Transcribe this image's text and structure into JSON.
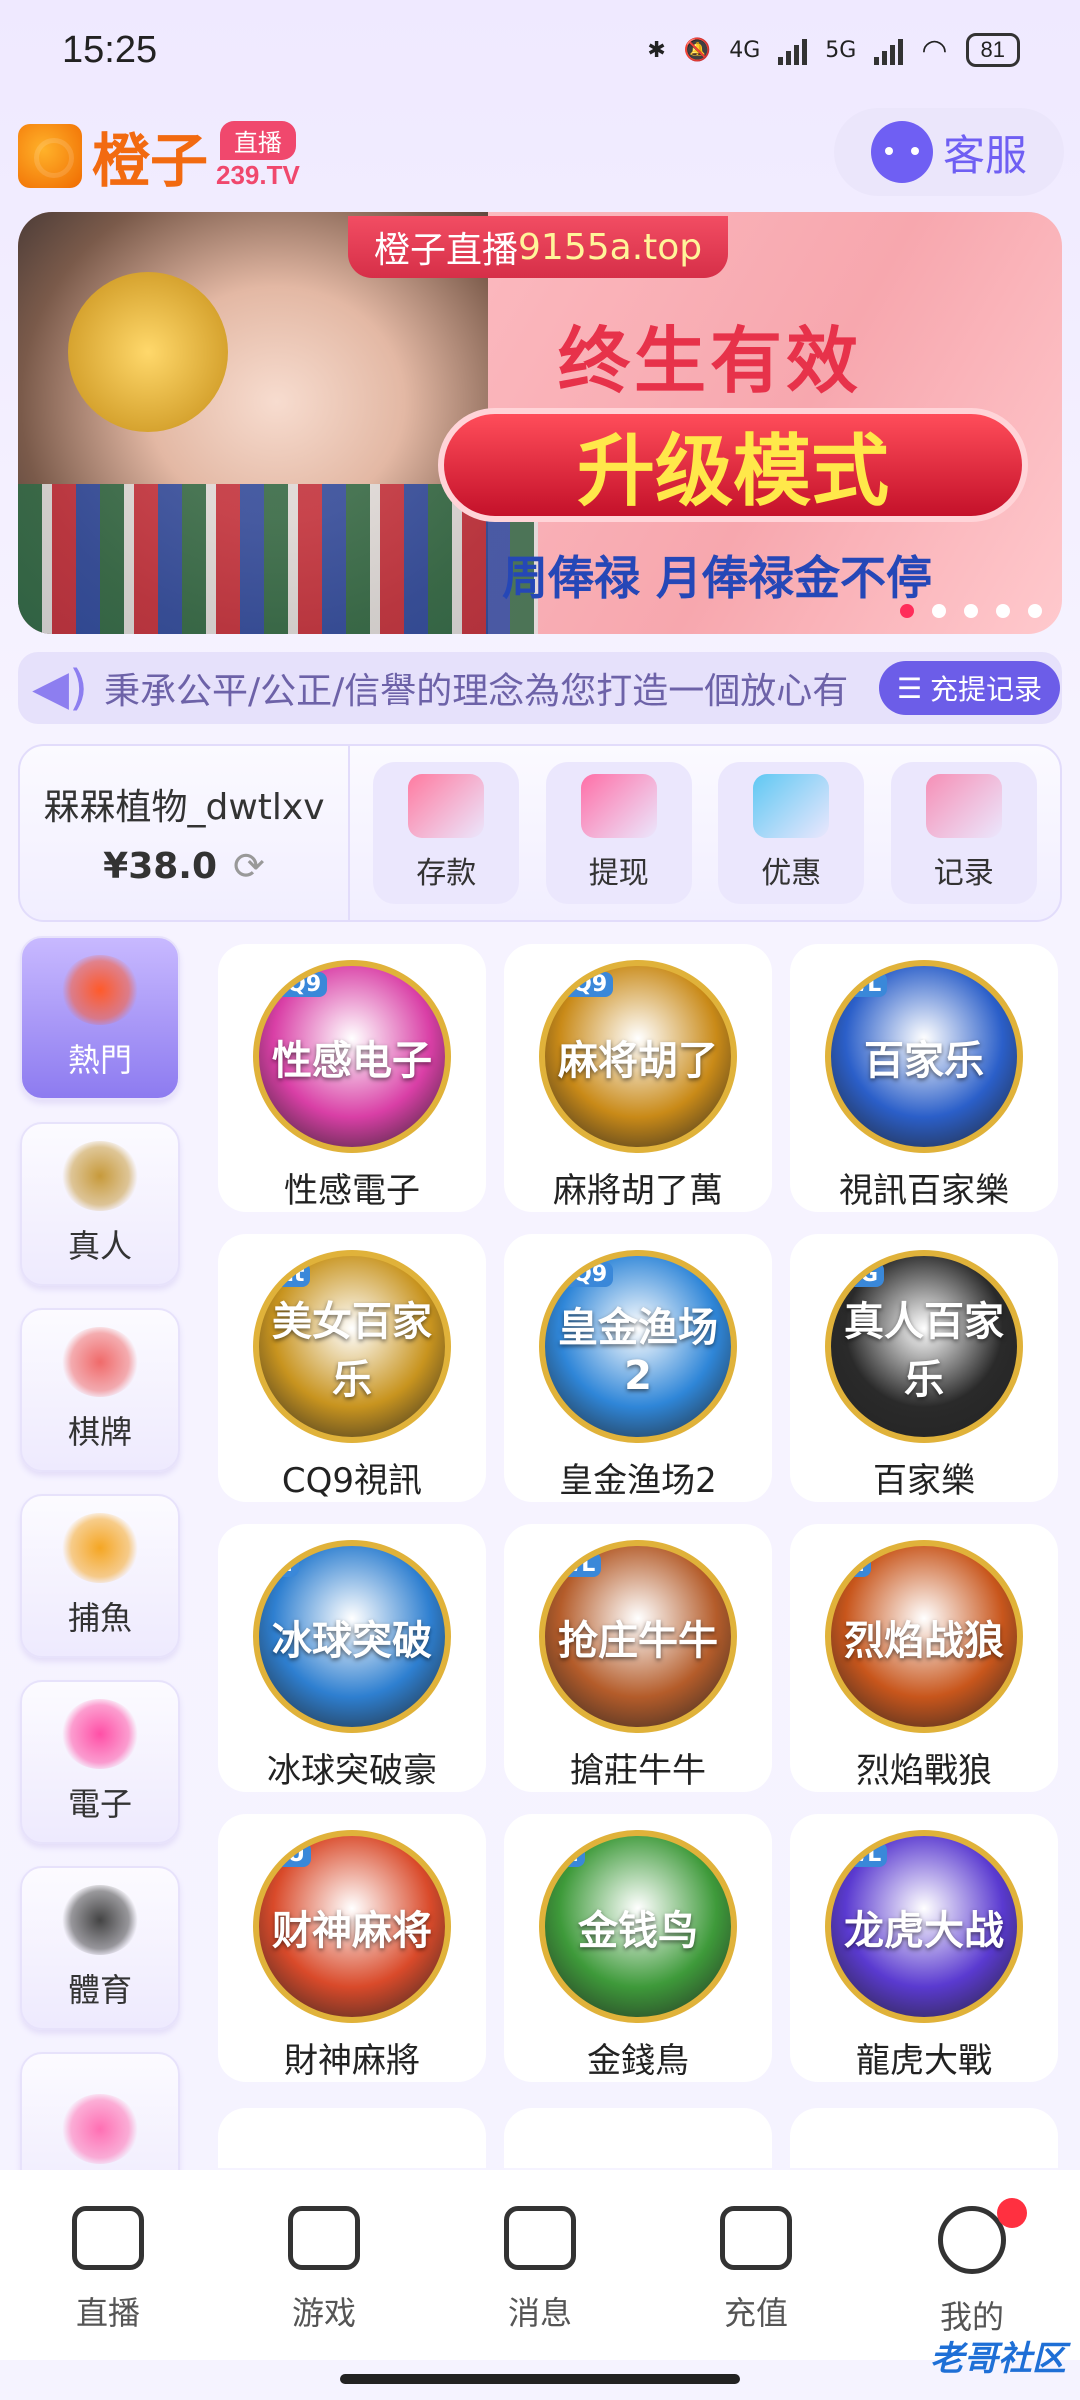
{
  "status": {
    "time": "15:25",
    "net1": "4G",
    "net2": "5G",
    "battery": "81"
  },
  "header": {
    "logo_name": "橙子",
    "logo_badge": "直播",
    "logo_domain": "239.TV",
    "service_label": "客服"
  },
  "banner": {
    "top_tag_prefix": "橙子直播",
    "top_tag_domain": "9155a.top",
    "headline": "终生有效",
    "pill_text": "升级模式",
    "subline": "周俸禄 月俸禄金不停",
    "dots_count": 5,
    "active_dot": 1
  },
  "marquee": {
    "text": "秉承公平/公正/信譽的理念為您打造一個放心有",
    "record_button": "充提记录"
  },
  "wallet": {
    "username": "槑槑植物_dwtlxv",
    "balance": "¥38.0",
    "actions": [
      {
        "label": "存款",
        "icon": "card-icon",
        "color": "#ff7aa0"
      },
      {
        "label": "提现",
        "icon": "money-bag-icon",
        "color": "#ff6fa7"
      },
      {
        "label": "优惠",
        "icon": "gift-icon",
        "color": "#5fc8f3"
      },
      {
        "label": "记录",
        "icon": "bar-chart-icon",
        "color": "#f68fb6"
      }
    ]
  },
  "categories": [
    {
      "label": "熱門",
      "icon": "fire-icon",
      "color": "#ff5a2a",
      "active": true
    },
    {
      "label": "真人",
      "icon": "poker-chip-icon",
      "color": "#c79a3b"
    },
    {
      "label": "棋牌",
      "icon": "cards-icon",
      "color": "#f06a6a"
    },
    {
      "label": "捕魚",
      "icon": "fish-icon",
      "color": "#f5a623"
    },
    {
      "label": "電子",
      "icon": "slot-machine-icon",
      "color": "#ff4fa6"
    },
    {
      "label": "體育",
      "icon": "soccer-ball-icon",
      "color": "#444444"
    },
    {
      "label": "",
      "icon": "lottery-ball-icon",
      "color": "#ff6fb3"
    }
  ],
  "games": [
    {
      "name": "性感電子",
      "provider": "CQ9",
      "art_text": "性感电子",
      "color": "#d93fa6"
    },
    {
      "name": "麻將胡了萬",
      "provider": "CQ9",
      "art_text": "麻将胡了",
      "color": "#c98a18"
    },
    {
      "name": "視訊百家樂",
      "provider": "WL",
      "art_text": "百家乐",
      "color": "#2b5fc9"
    },
    {
      "name": "CQ9視訊",
      "provider": "mt",
      "art_text": "美女百家乐",
      "color": "#c8941f"
    },
    {
      "name": "皇金渔场2",
      "provider": "CQ9",
      "art_text": "皇金渔场2",
      "color": "#2f86d8"
    },
    {
      "name": "百家樂",
      "provider": "AG",
      "art_text": "真人百家乐",
      "color": "#2a2a2a"
    },
    {
      "name": "冰球突破豪",
      "provider": "M",
      "art_text": "冰球突破",
      "color": "#2e7fd0"
    },
    {
      "name": "搶莊牛牛",
      "provider": "WL",
      "art_text": "抢庄牛牛",
      "color": "#b45c2a"
    },
    {
      "name": "烈焰戰狼",
      "provider": "M",
      "art_text": "烈焰战狼",
      "color": "#c8561c"
    },
    {
      "name": "財神麻將",
      "provider": "PU",
      "art_text": "财神麻将",
      "color": "#d94a2a"
    },
    {
      "name": "金錢鳥",
      "provider": "M",
      "art_text": "金钱鸟",
      "color": "#3e9a3a"
    },
    {
      "name": "龍虎大戰",
      "provider": "WL",
      "art_text": "龙虎大战",
      "color": "#5a3ad0"
    }
  ],
  "nav": [
    {
      "label": "直播",
      "icon": "camera-icon"
    },
    {
      "label": "游戏",
      "icon": "gamepad-icon"
    },
    {
      "label": "消息",
      "icon": "chat-icon"
    },
    {
      "label": "充值",
      "icon": "wallet-icon"
    },
    {
      "label": "我的",
      "icon": "smile-icon",
      "badge": true
    }
  ],
  "watermark": "老哥社区"
}
